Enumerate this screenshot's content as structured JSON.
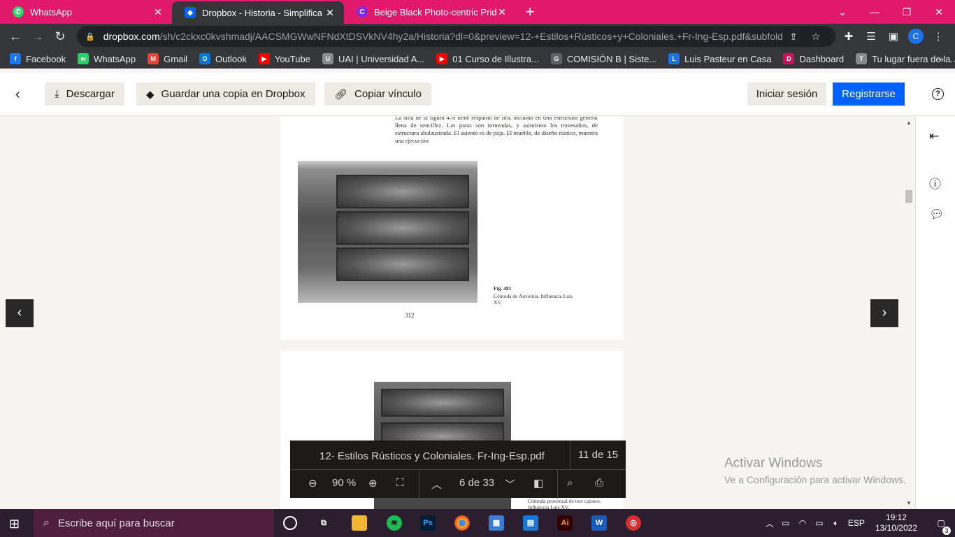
{
  "browser": {
    "tabs": [
      {
        "title": "WhatsApp",
        "favicon": "whatsapp-icon",
        "color": "#25d366"
      },
      {
        "title": "Dropbox - Historia - Simplifica tu",
        "favicon": "dropbox-icon",
        "color": "#0061fe"
      },
      {
        "title": "Beige Black Photo-centric Pride S",
        "favicon": "canva-icon",
        "color": "#7d2ae8"
      }
    ],
    "url_domain": "dropbox.com",
    "url_path": "/sh/c2ckxc0kvshmadj/AACSMGWwNFNdXtDSVkNV4hy2a/Historia?dl=0&preview=12-+Estilos+Rústicos+y+Coloniales.+Fr-Ing-Esp.pdf&subfold...",
    "profile_initial": "C",
    "bookmarks": [
      {
        "label": "Facebook",
        "color": "#1877f2",
        "glyph": "f"
      },
      {
        "label": "WhatsApp",
        "color": "#25d366",
        "glyph": "w"
      },
      {
        "label": "Gmail",
        "color": "#ea4335",
        "glyph": "M"
      },
      {
        "label": "Outlook",
        "color": "#0078d4",
        "glyph": "O"
      },
      {
        "label": "YouTube",
        "color": "#ff0000",
        "glyph": "▶"
      },
      {
        "label": "UAI | Universidad A...",
        "color": "#8a8a8a",
        "glyph": "U"
      },
      {
        "label": "01 Curso de Illustra...",
        "color": "#ff0000",
        "glyph": "▶"
      },
      {
        "label": "COMISIÓN B | Siste...",
        "color": "#5f6368",
        "glyph": "G"
      },
      {
        "label": "Luis Pasteur en Casa",
        "color": "#1a73e8",
        "glyph": "L"
      },
      {
        "label": "Dashboard",
        "color": "#c2185b",
        "glyph": "D"
      },
      {
        "label": "Tu lugar fuera de la...",
        "color": "#8a8a8a",
        "glyph": "T"
      }
    ]
  },
  "toolbar": {
    "download": "Descargar",
    "save_copy": "Guardar una copia en Dropbox",
    "copy_link": "Copiar vínculo",
    "sign_in": "Iniciar sesión",
    "register": "Registrarse"
  },
  "document": {
    "page1_text": "La silla de la figura 478 tiene respaldo de lira, incluido en una estructura general llena de sencillez. Las patas son torneadas, y asimismo los travesaños, de estructura abalaustrada. El asiento es de paja. El mueble, de diseño rústico, muestra una ejecución",
    "fig_label": "Fig. 481",
    "fig_caption": "Cómoda de Auvernia. Influencia Luis XV.",
    "page_number": "312",
    "page2_caption": "Cómoda provenzal de tres cajones. Influencia Luis XV."
  },
  "viewer_controls": {
    "filename": "12- Estilos Rústicos y Coloniales. Fr-Ing-Esp.pdf",
    "file_position": "11 de 15",
    "zoom": "90 %",
    "page_position": "6 de 33"
  },
  "watermark": {
    "line1": "Activar Windows",
    "line2": "Ve a Configuración para activar Windows."
  },
  "taskbar": {
    "search_placeholder": "Escribe aquí para buscar",
    "language": "ESP",
    "time": "19:12",
    "date": "13/10/2022",
    "notifications": "3"
  },
  "colors": {
    "accent_tabstrip": "#e0196b",
    "dropbox_blue": "#0061fe"
  }
}
